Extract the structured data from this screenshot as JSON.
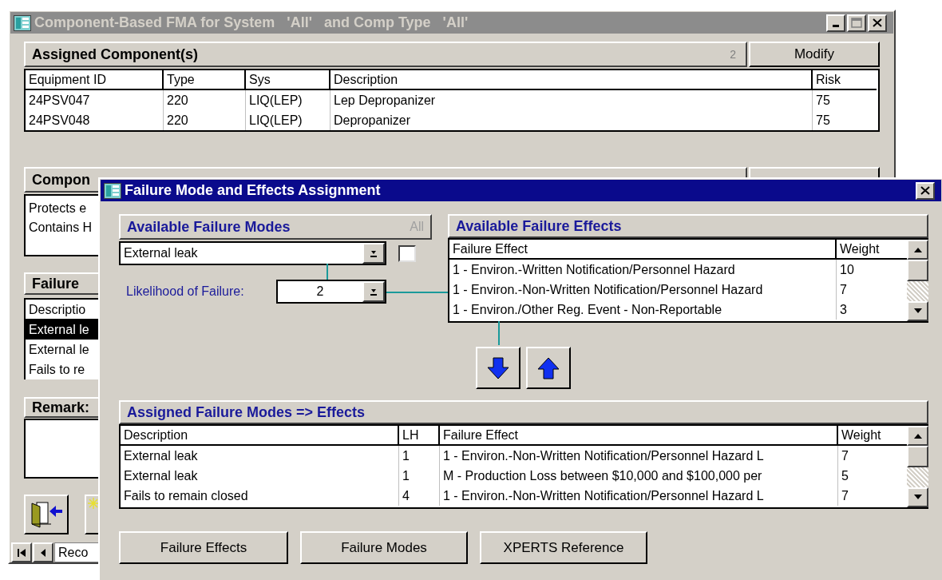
{
  "main_window": {
    "title": "Component-Based FMA for System   'All'   and Comp Type   'All'",
    "active": false,
    "assigned_components": {
      "title": "Assigned Component(s)",
      "count": "2",
      "button": "Modify",
      "columns": [
        "Equipment ID",
        "Type",
        "Sys",
        "Description",
        "Risk"
      ],
      "rows": [
        [
          "24PSV047",
          "220",
          "LIQ(LEP)",
          "Lep Depropanizer",
          "75"
        ],
        [
          "24PSV048",
          "220",
          "LIQ(LEP)",
          "Depropanizer",
          "75"
        ]
      ]
    },
    "component_panel": {
      "title": "Compon",
      "lines": [
        "Protects e",
        "Contains H"
      ]
    },
    "failure_panel": {
      "title": "Failure",
      "column": "Descriptio",
      "rows": [
        {
          "text": "External le",
          "selected": true
        },
        {
          "text": "External le",
          "selected": false
        },
        {
          "text": "Fails to re",
          "selected": false
        }
      ]
    },
    "remarks_panel": {
      "title": "Remark:"
    },
    "record_nav": {
      "field": "Reco"
    }
  },
  "dialog": {
    "title": "Failure Mode and Effects Assignment",
    "active": true,
    "available_modes": {
      "title": "Available Failure Modes",
      "all_button": {
        "label": "All",
        "disabled": true
      },
      "selected_mode": "External leak",
      "all_checked": false,
      "likelihood_label": "Likelihood of Failure:",
      "likelihood": "2"
    },
    "available_effects": {
      "title": "Available Failure Effects",
      "columns": [
        "Failure Effect",
        "Weight"
      ],
      "rows": [
        [
          "1 - Environ.-Written Notification/Personnel Hazard",
          "10"
        ],
        [
          "1 - Environ.-Non-Written Notification/Personnel Hazard",
          "7"
        ],
        [
          "1 - Environ./Other Reg. Event - Non-Reportable",
          "3"
        ]
      ]
    },
    "assigned": {
      "title": "Assigned Failure Modes => Effects",
      "columns": [
        "Description",
        "LH",
        "Failure Effect",
        "Weight"
      ],
      "rows": [
        [
          "External leak",
          "1",
          "1 - Environ.-Non-Written Notification/Personnel Hazard L",
          "7"
        ],
        [
          "External leak",
          "1",
          "M - Production Loss between $10,000 and $100,000 per",
          "5"
        ],
        [
          "Fails to remain closed",
          "4",
          "1 - Environ.-Non-Written Notification/Personnel Hazard L",
          "7"
        ]
      ]
    },
    "buttons": [
      "Failure Effects",
      "Failure Modes",
      "XPERTS Reference"
    ]
  }
}
